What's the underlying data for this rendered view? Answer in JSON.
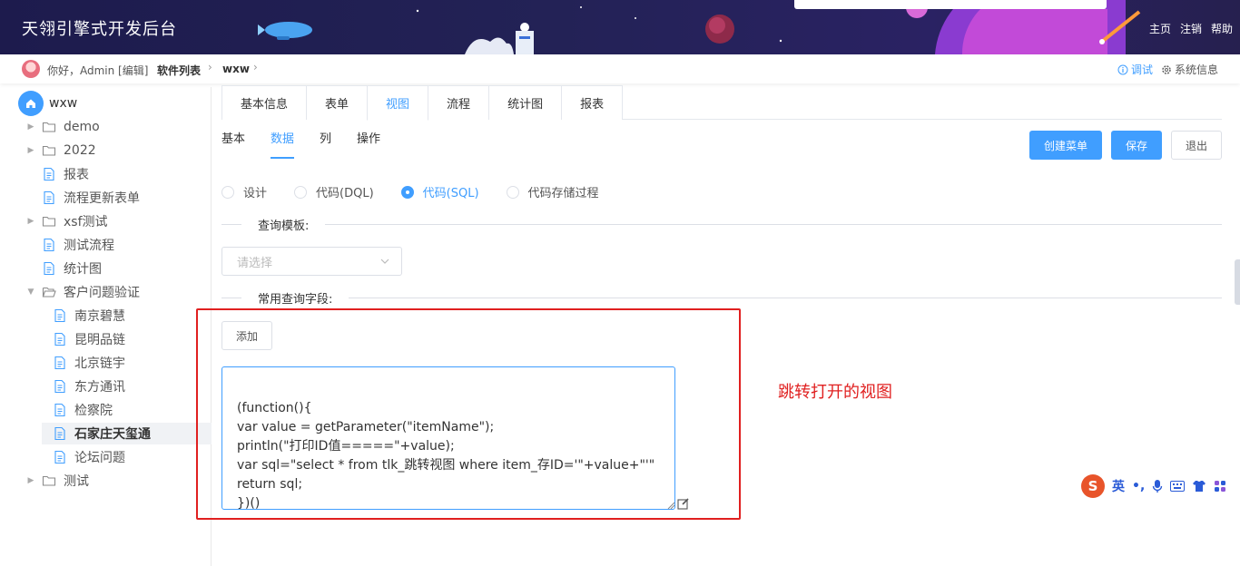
{
  "header": {
    "title": "天翎引擎式开发后台",
    "nav": [
      "主页",
      "注销",
      "帮助"
    ]
  },
  "breadcrumb": {
    "greeting": "你好，Admin [编辑]",
    "items": [
      "软件列表",
      "wxw"
    ],
    "debug_label": "调试",
    "sysinfo_label": "系统信息"
  },
  "sidebar": {
    "root": "wxw",
    "items": [
      {
        "label": "demo",
        "type": "folder",
        "expandable": true
      },
      {
        "label": "2022",
        "type": "folder",
        "expandable": true
      },
      {
        "label": "报表",
        "type": "file"
      },
      {
        "label": "流程更新表单",
        "type": "file"
      },
      {
        "label": "xsf测试",
        "type": "folder",
        "expandable": true
      },
      {
        "label": "测试流程",
        "type": "file"
      },
      {
        "label": "统计图",
        "type": "file"
      },
      {
        "label": "客户问题验证",
        "type": "folder-open",
        "expanded": true
      },
      {
        "label": "南京碧慧",
        "type": "file",
        "child": true
      },
      {
        "label": "昆明品链",
        "type": "file",
        "child": true
      },
      {
        "label": "北京链宇",
        "type": "file",
        "child": true
      },
      {
        "label": "东方通讯",
        "type": "file",
        "child": true
      },
      {
        "label": "检察院",
        "type": "file",
        "child": true
      },
      {
        "label": "石家庄天玺通",
        "type": "file",
        "child": true,
        "selected": true
      },
      {
        "label": "论坛问题",
        "type": "file",
        "child": true
      },
      {
        "label": "测试",
        "type": "folder",
        "expandable": true
      }
    ]
  },
  "tabs": [
    "基本信息",
    "表单",
    "视图",
    "流程",
    "统计图",
    "报表"
  ],
  "active_tab": "视图",
  "subtabs": [
    "基本",
    "数据",
    "列",
    "操作"
  ],
  "active_subtab": "数据",
  "buttons": {
    "create_menu": "创建菜单",
    "save": "保存",
    "exit": "退出",
    "add": "添加"
  },
  "radios": [
    "设计",
    "代码(DQL)",
    "代码(SQL)",
    "代码存储过程"
  ],
  "active_radio": "代码(SQL)",
  "sections": {
    "query_template": "查询模板:",
    "common_fields": "常用查询字段:"
  },
  "select": {
    "placeholder": "请选择"
  },
  "code": "\n(function(){\nvar value = getParameter(\"itemName\");\nprintln(\"打印ID值=====\"+value);\nvar sql=\"select * from tlk_跳转视图 where item_存ID='\"+value+\"'\"\nreturn sql;\n})()",
  "annotation": "跳转打开的视图",
  "ime": {
    "lang": "英",
    "punct": "•,"
  },
  "colors": {
    "accent": "#409eff",
    "header_bg": "#1d1b4d",
    "annotation": "#e02020"
  }
}
